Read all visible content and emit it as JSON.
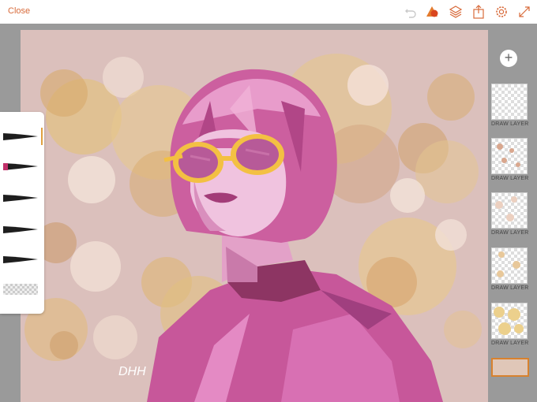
{
  "toolbar": {
    "close_label": "Close",
    "icons": [
      "undo-icon",
      "color-shapes-icon",
      "layers-icon",
      "share-icon",
      "settings-icon",
      "expand-icon"
    ],
    "accent_color": "#d86a3a"
  },
  "canvas": {
    "signature_text": "DHH"
  },
  "brushes": [
    {
      "name": "brush-1",
      "color": "#222222",
      "active": true
    },
    {
      "name": "brush-2",
      "color": "#c0306a",
      "active": false
    },
    {
      "name": "brush-3",
      "color": "#222222",
      "active": false
    },
    {
      "name": "brush-4",
      "color": "#222222",
      "active": false
    },
    {
      "name": "brush-5",
      "color": "#222222",
      "active": false
    }
  ],
  "layers": {
    "add_label": "+",
    "items": [
      {
        "label": "DRAW LAYER"
      },
      {
        "label": "DRAW LAYER"
      },
      {
        "label": "DRAW LAYER"
      },
      {
        "label": "DRAW LAYER"
      },
      {
        "label": "DRAW LAYER"
      }
    ]
  }
}
